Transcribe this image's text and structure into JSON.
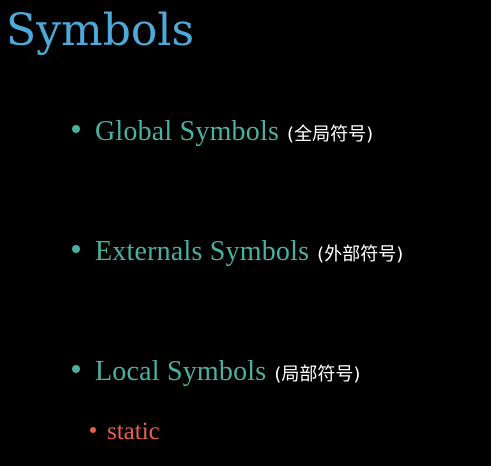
{
  "slide": {
    "title": "Symbols",
    "items": [
      {
        "label": "Global Symbols",
        "note": "(全局符号)"
      },
      {
        "label": "Externals Symbols",
        "note": "(外部符号)"
      },
      {
        "label": "Local Symbols",
        "note": "(局部符号)"
      }
    ],
    "sub_items": [
      {
        "label": "static"
      }
    ]
  },
  "colors": {
    "background": "#000000",
    "title": "#4ea8d8",
    "bullet_text": "#4ab0a0",
    "note_text": "#ffffff",
    "sub_bullet_text": "#e8604a"
  }
}
